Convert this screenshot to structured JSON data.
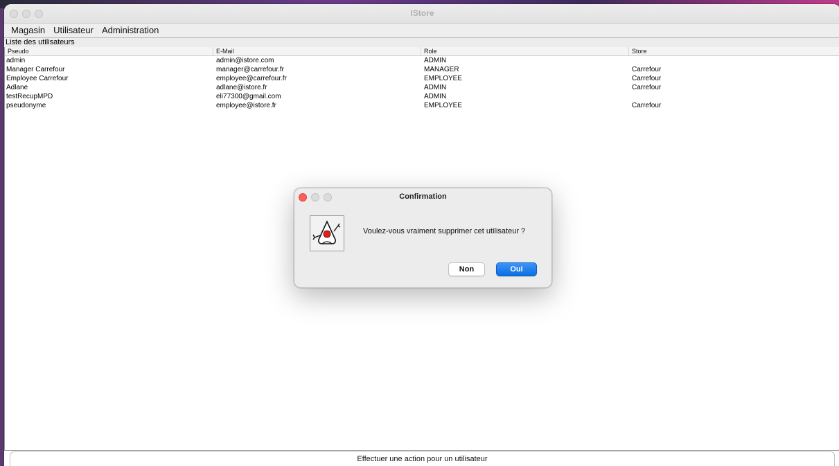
{
  "window": {
    "title": "IStore"
  },
  "menu": {
    "items": [
      "Magasin",
      "Utilisateur",
      "Administration"
    ]
  },
  "panel": {
    "title": "Liste des utilisateurs"
  },
  "table": {
    "columns": [
      "Pseudo",
      "E-Mail",
      "Role",
      "Store"
    ],
    "rows": [
      [
        "admin",
        "admin@istore.com",
        "ADMIN",
        ""
      ],
      [
        "Manager Carrefour",
        "manager@carrefour.fr",
        "MANAGER",
        "Carrefour"
      ],
      [
        "Employee Carrefour",
        "employee@carrefour.fr",
        "EMPLOYEE",
        "Carrefour"
      ],
      [
        "Adlane",
        "adlane@istore.fr",
        "ADMIN",
        "Carrefour"
      ],
      [
        "testRecupMPD",
        "eli77300@gmail.com",
        "ADMIN",
        ""
      ],
      [
        "pseudonyme",
        "employee@istore.fr",
        "EMPLOYEE",
        "Carrefour"
      ]
    ]
  },
  "action_bar": {
    "label": "Effectuer une action pour un utilisateur"
  },
  "dialog": {
    "title": "Confirmation",
    "icon": "duke-java-icon",
    "message": "Voulez-vous vraiment supprimer cet utilisateur ?",
    "buttons": {
      "no": "Non",
      "yes": "Oui"
    }
  },
  "colors": {
    "accent": "#0b6fe4",
    "close": "#fe5f57"
  }
}
